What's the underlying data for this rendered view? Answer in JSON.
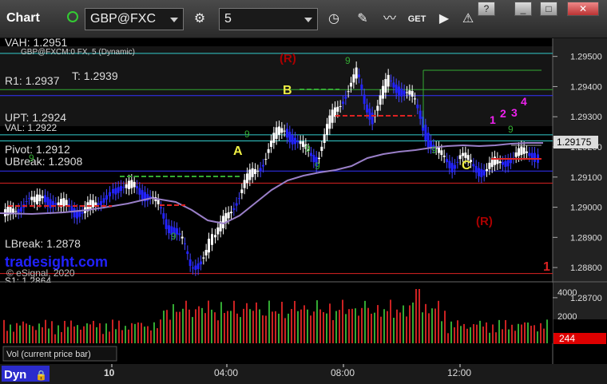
{
  "toolbar": {
    "app_title": "Chart",
    "symbol": "GBP@FXC",
    "interval": "5",
    "get_label": "GET"
  },
  "window_controls": {
    "help": "?",
    "minimize": "_",
    "restore": "□",
    "close": "✕"
  },
  "chart": {
    "study_label": "GBP@FXCM:0 FX, 5 (Dynamic)",
    "copyright": "© eSignal, 2020",
    "watermark": "tradesight.com",
    "current_price": "1.29175",
    "levels": [
      {
        "label": "VAH: 1.2951",
        "price": 1.2951,
        "color": "#3cc"
      },
      {
        "label": "R1: 1.2937",
        "price": 1.2937,
        "color": "#33f"
      },
      {
        "label": "T: 1.2939",
        "price": 1.2939,
        "color": "#3a3"
      },
      {
        "label": "UPT: 1.2924",
        "price": 1.2924,
        "color": "#3cc"
      },
      {
        "label": "VAL: 1.2922",
        "price": 1.2922,
        "color": "#3cc"
      },
      {
        "label": "Pivot: 1.2912",
        "price": 1.2912,
        "color": "#33f"
      },
      {
        "label": "UBreak: 1.2908",
        "price": 1.2908,
        "color": "#d22"
      },
      {
        "label": "LBreak: 1.2878",
        "price": 1.2878,
        "color": "#d22"
      },
      {
        "label": "S1: 1.2864",
        "price": 1.2864,
        "color": "#d22"
      }
    ],
    "price_ticks": [
      "1.29500",
      "1.29400",
      "1.29300",
      "1.29200",
      "1.29100",
      "1.29000",
      "1.28900",
      "1.28800",
      "1.28700"
    ],
    "markers": {
      "A": "A",
      "B": "B",
      "C": "C",
      "R_top": "(R)",
      "R_bottom": "(R)",
      "count1": "1",
      "count2": "2",
      "count3": "3",
      "count4": "4",
      "red_one": "1"
    },
    "seq_labels": [
      "9",
      "9",
      "9",
      "9",
      "9",
      "9",
      "9",
      "9"
    ]
  },
  "volume": {
    "label": "Vol (current price bar)",
    "current": "244",
    "ticks": [
      "4000",
      "2000"
    ]
  },
  "time_axis": {
    "dyn": "Dyn",
    "labels": [
      "10",
      "04:00",
      "08:00",
      "12:00"
    ]
  },
  "chart_data": {
    "type": "candlestick",
    "price_range": [
      1.2866,
      1.2956
    ],
    "level_lines": [
      1.2951,
      1.2939,
      1.2937,
      1.2924,
      1.2922,
      1.2912,
      1.2908,
      1.2878,
      1.2864
    ]
  }
}
